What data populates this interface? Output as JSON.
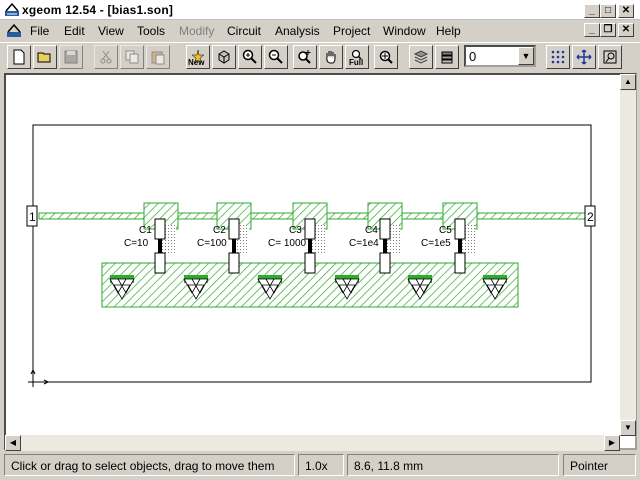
{
  "window": {
    "title": "xgeom 12.54 - [bias1.son]"
  },
  "menu": {
    "items": [
      {
        "key": "file",
        "label": "File",
        "enabled": true
      },
      {
        "key": "edit",
        "label": "Edit",
        "enabled": true
      },
      {
        "key": "view",
        "label": "View",
        "enabled": true
      },
      {
        "key": "tools",
        "label": "Tools",
        "enabled": true
      },
      {
        "key": "modify",
        "label": "Modify",
        "enabled": false
      },
      {
        "key": "circuit",
        "label": "Circuit",
        "enabled": true
      },
      {
        "key": "analysis",
        "label": "Analysis",
        "enabled": true
      },
      {
        "key": "project",
        "label": "Project",
        "enabled": true
      },
      {
        "key": "window",
        "label": "Window",
        "enabled": true
      },
      {
        "key": "help",
        "label": "Help",
        "enabled": true
      }
    ]
  },
  "toolbar": {
    "new_label": "New",
    "full_label": "Full",
    "level_value": "0"
  },
  "layout": {
    "ports": [
      {
        "label": "1"
      },
      {
        "label": "2"
      }
    ],
    "capacitors": [
      {
        "name": "C1",
        "value": "C=10"
      },
      {
        "name": "C2",
        "value": "C=100"
      },
      {
        "name": "C3",
        "value": "C= 1000"
      },
      {
        "name": "C4",
        "value": "C=1e4"
      },
      {
        "name": "C5",
        "value": "C=1e5"
      }
    ],
    "colors": {
      "metal": "#2eaa2e",
      "background": "#ffffff"
    }
  },
  "status": {
    "hint": "Click or drag to select objects, drag to move them",
    "zoom": "1.0x",
    "coords": "8.6, 11.8 mm",
    "mode": "Pointer"
  }
}
